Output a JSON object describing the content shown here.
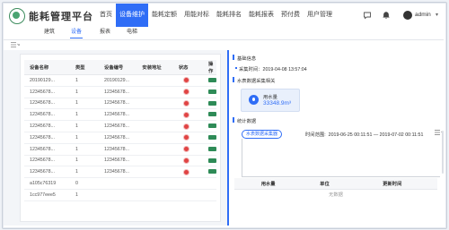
{
  "app": {
    "title": "能耗管理平台"
  },
  "nav": {
    "items": [
      "首页",
      "设备维护",
      "能耗定额",
      "用能对标",
      "能耗排名",
      "能耗报表",
      "预付费",
      "用户管理"
    ],
    "active_index": 1
  },
  "user": {
    "name": "admin"
  },
  "icons": {
    "message": "message-icon",
    "bell": "bell-icon",
    "avatar": "avatar-icon",
    "menu": "menu-toggle-icon"
  },
  "subtabs": {
    "items": [
      "建筑",
      "设备",
      "报表",
      "电梯"
    ],
    "active_index": 1
  },
  "device_table": {
    "headers": [
      "设备名称",
      "类型",
      "设备编号",
      "安装地址",
      "状态",
      "操作"
    ],
    "rows": [
      [
        "20190129...",
        "1",
        "20190129...",
        "",
        "",
        ""
      ],
      [
        "12345678...",
        "1",
        "12345678...",
        "",
        "",
        ""
      ],
      [
        "12345678...",
        "1",
        "12345678...",
        "",
        "",
        ""
      ],
      [
        "12345678...",
        "1",
        "12345678...",
        "",
        "",
        ""
      ],
      [
        "12345678...",
        "1",
        "12345678...",
        "",
        "",
        ""
      ],
      [
        "12345678...",
        "1",
        "12345678...",
        "",
        "",
        ""
      ],
      [
        "12345678...",
        "1",
        "12345678...",
        "",
        "",
        ""
      ],
      [
        "12345678...",
        "1",
        "12345678...",
        "",
        "",
        ""
      ],
      [
        "12345678...",
        "1",
        "12345678...",
        "",
        "",
        ""
      ],
      [
        "a105c76319",
        "0",
        "",
        "",
        "",
        ""
      ],
      [
        "1cc977eee5",
        "1",
        "",
        "",
        "",
        ""
      ]
    ],
    "status_color": "#e04343",
    "action_color": "#2e8b57"
  },
  "detail": {
    "basic_info_title": "基础信息",
    "collect_time_label": "采集时间：",
    "collect_time_value": "2019-04-08 13:57:04",
    "water_section_title": "水表数据采集相关",
    "water_label": "用水量",
    "water_value": "33348.9m³",
    "stats_title": "统计数据",
    "collect_tag": "水表数据采集器",
    "range_label": "时间范围:",
    "range_value": "2019-06-25 00:11:51 — 2019-07-02 00:11:51",
    "table_headers": [
      "用水量",
      "单位",
      "更新时间"
    ],
    "empty_text": "无数据"
  },
  "colors": {
    "accent": "#2f6df6",
    "brand_green": "#4aa471"
  }
}
